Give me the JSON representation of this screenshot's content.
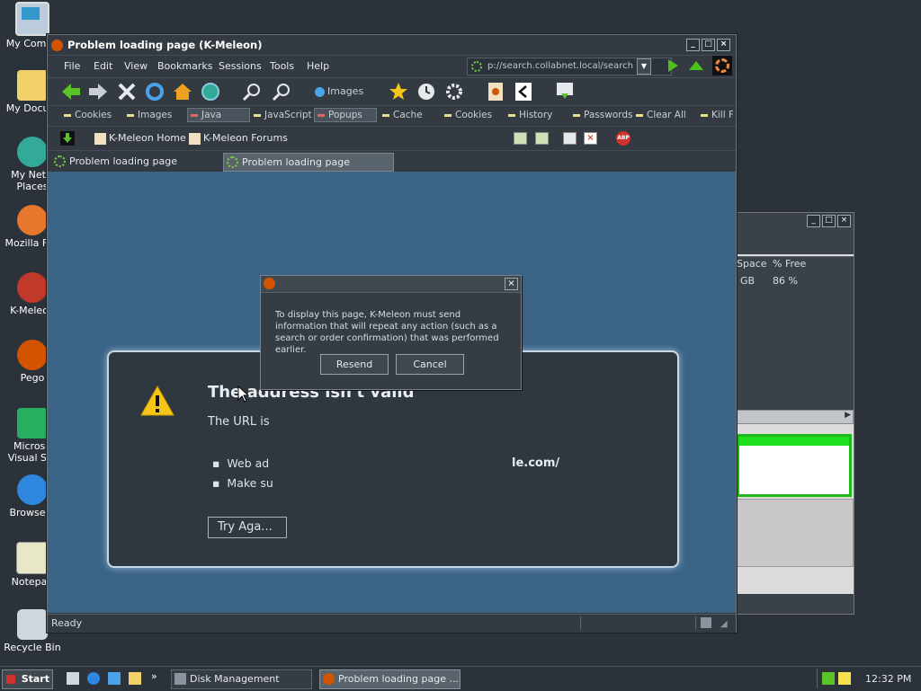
{
  "desktop": {
    "icons": [
      {
        "label": "My Compu",
        "icon": "computer-icon"
      },
      {
        "label": "My Docum",
        "icon": "folder-icon"
      },
      {
        "label": "My Netw\nPlaces",
        "icon": "network-icon"
      },
      {
        "label": "Mozilla Fire",
        "icon": "firefox-icon"
      },
      {
        "label": "K-Meleon",
        "icon": "kmeleon-icon"
      },
      {
        "label": "Pego",
        "icon": "pego-icon"
      },
      {
        "label": "Microso\nVisual Stu",
        "icon": "visual-studio-icon"
      },
      {
        "label": "Browserv",
        "icon": "ie-icon"
      },
      {
        "label": "Notepad",
        "icon": "notepad-icon"
      },
      {
        "label": "Recycle Bin",
        "icon": "recycle-bin-icon"
      }
    ]
  },
  "bg_window": {
    "col_space": "Space",
    "col_free": "% Free",
    "row_space": "GB",
    "row_free": "86 %"
  },
  "window": {
    "title": "Problem loading page (K-Meleon)",
    "menu": [
      "File",
      "Edit",
      "View",
      "Bookmarks",
      "Sessions",
      "Tools",
      "Help"
    ],
    "url": "p://search.collabnet.local/search",
    "images_label": "Images",
    "prefs": [
      "Cookies",
      "Images",
      "Java",
      "JavaScript",
      "Popups",
      "Cache",
      "Cookies",
      "History",
      "Passwords",
      "Clear All",
      "Kill Fl"
    ],
    "bookmarks": [
      "K-Meleon Home",
      "K-Meleon Forums"
    ],
    "tabs": [
      "Problem loading page",
      "Problem loading page"
    ],
    "status": "Ready"
  },
  "error": {
    "title": "The address isn't valid",
    "desc": "The URL is",
    "bullet1": "Web ad",
    "bullet2": "Make su",
    "url_fragment": "le.com/",
    "try_again": "Try Aga..."
  },
  "dialog": {
    "message": "To display this page, K-Meleon must send information that will repeat any action (such as a search or order confirmation) that was performed earlier.",
    "resend": "Resend",
    "cancel": "Cancel"
  },
  "taskbar": {
    "start": "Start",
    "tasks": [
      "Disk Management",
      "Problem loading page ..."
    ],
    "clock": "12:32 PM"
  }
}
